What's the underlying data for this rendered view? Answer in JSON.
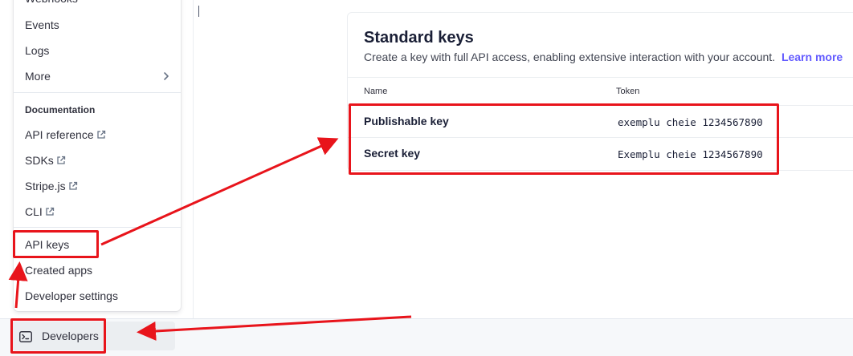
{
  "menu": {
    "items_top": [
      {
        "label": "Webhooks"
      },
      {
        "label": "Events"
      },
      {
        "label": "Logs"
      },
      {
        "label": "More"
      }
    ],
    "documentation_heading": "Documentation",
    "doc_items": [
      {
        "label": "API reference"
      },
      {
        "label": "SDKs"
      },
      {
        "label": "Stripe.js"
      },
      {
        "label": "CLI"
      }
    ],
    "items_bottom": [
      {
        "label": "API keys"
      },
      {
        "label": "Created apps"
      },
      {
        "label": "Developer settings"
      }
    ]
  },
  "bottom_bar": {
    "developers_label": "Developers",
    "developers_icon": "terminal-icon"
  },
  "standard_keys": {
    "title": "Standard keys",
    "subtitle": "Create a key with full API access, enabling extensive interaction with your account.",
    "learn_more": "Learn more",
    "columns": [
      "Name",
      "Token"
    ],
    "rows": [
      {
        "name": "Publishable key",
        "token": "exemplu cheie 1234567890"
      },
      {
        "name": "Secret key",
        "token": "Exemplu cheie 1234567890"
      }
    ]
  },
  "annotation_color": "#e8141b",
  "link_color": "#635bff"
}
